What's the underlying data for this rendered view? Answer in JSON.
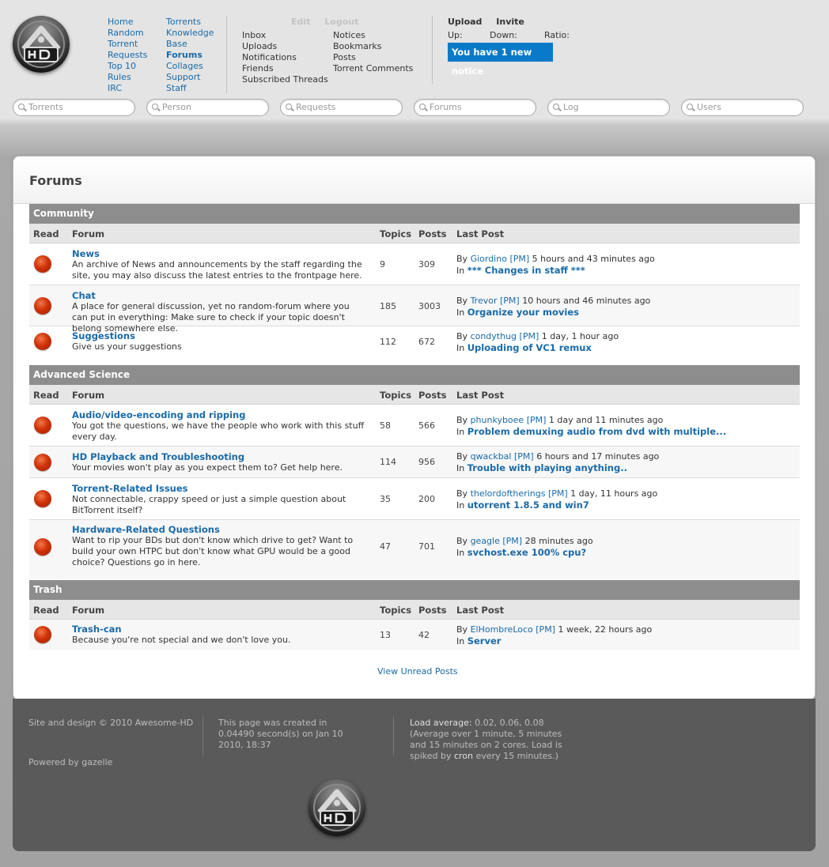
{
  "header": {
    "nav_col1": [
      "Home",
      "Random Torrent",
      "Requests",
      "Top 10",
      "Rules",
      "IRC"
    ],
    "nav_col2": [
      "Torrents",
      "Knowledge Base",
      "Forums",
      "Collages",
      "Support",
      "Staff"
    ],
    "user_edit": "Edit",
    "user_logout": "Logout",
    "user_links_col1": [
      "Inbox",
      "Uploads",
      "Notifications",
      "Friends",
      "Subscribed Threads"
    ],
    "user_links_col2": [
      "Notices",
      "Bookmarks",
      "Posts",
      "Torrent Comments"
    ],
    "upload": "Upload",
    "invite": "Invite",
    "stat_up": "Up:",
    "stat_down": "Down:",
    "stat_ratio": "Ratio:",
    "notice": "You have 1 new notice"
  },
  "searches": [
    "Torrents",
    "Person",
    "Requests",
    "Forums",
    "Log",
    "Users"
  ],
  "page_title": "Forums",
  "columns": {
    "read": "Read",
    "forum": "Forum",
    "topics": "Topics",
    "posts": "Posts",
    "last_post": "Last Post"
  },
  "categories": [
    {
      "name": "Community",
      "forums": [
        {
          "name": "News",
          "desc": "An archive of News and announcements by the staff regarding the site, you may also discuss the latest entries to the frontpage here.",
          "topics": "9",
          "posts": "309",
          "by": "By",
          "user": "Giordino",
          "pm": "[PM]",
          "time": "5 hours and 43 minutes ago",
          "in": "In",
          "thread": "*** Changes in staff ***"
        },
        {
          "name": "Chat",
          "desc": "A place for general discussion, yet no random-forum where you can put in everything: Make sure to check if your topic doesn't belong somewhere else.",
          "topics": "185",
          "posts": "3003",
          "by": "By",
          "user": "Trevor",
          "pm": "[PM]",
          "time": "10 hours and 46 minutes ago",
          "in": "In",
          "thread": "Organize your movies"
        },
        {
          "name": "Suggestions",
          "desc": "Give us your suggestions",
          "topics": "112",
          "posts": "672",
          "by": "By",
          "user": "condythug",
          "pm": "[PM]",
          "time": "1 day, 1 hour ago",
          "in": "In",
          "thread": "Uploading of VC1 remux"
        }
      ]
    },
    {
      "name": "Advanced Science",
      "forums": [
        {
          "name": "Audio/video-encoding and ripping",
          "desc": "You got the questions, we have the people who work with this stuff every day.",
          "topics": "58",
          "posts": "566",
          "by": "By",
          "user": "phunkyboee",
          "pm": "[PM]",
          "time": "1 day and 11 minutes ago",
          "in": "In",
          "thread": "Problem demuxing audio from dvd with multiple..."
        },
        {
          "name": "HD Playback and Troubleshooting",
          "desc": "Your movies won't play as you expect them to? Get help here.",
          "topics": "114",
          "posts": "956",
          "by": "By",
          "user": "qwackbal",
          "pm": "[PM]",
          "time": "6 hours and 17 minutes ago",
          "in": "In",
          "thread": "Trouble with playing anything.."
        },
        {
          "name": "Torrent-Related Issues",
          "desc": "Not connectable, crappy speed or just a simple question about BitTorrent itself?",
          "topics": "35",
          "posts": "200",
          "by": "By",
          "user": "thelordoftherings",
          "pm": "[PM]",
          "time": "1 day, 11 hours ago",
          "in": "In",
          "thread": "utorrent 1.8.5 and win7"
        },
        {
          "name": "Hardware-Related Questions",
          "desc": "Want to rip your BDs but don't know which drive to get? Want to build your own HTPC but don't know what GPU would be a good choice? Questions go in here.",
          "topics": "47",
          "posts": "701",
          "by": "By",
          "user": "geagle",
          "pm": "[PM]",
          "time": "28 minutes ago",
          "in": "In",
          "thread": "svchost.exe 100% cpu?"
        }
      ]
    },
    {
      "name": "Trash",
      "forums": [
        {
          "name": "Trash-can",
          "desc": "Because you're not special and we don't love you.",
          "topics": "13",
          "posts": "42",
          "by": "By",
          "user": "ElHombreLoco",
          "pm": "[PM]",
          "time": "1 week, 22 hours ago",
          "in": "In",
          "thread": "Server"
        }
      ]
    }
  ],
  "view_unread": "View Unread Posts",
  "footer": {
    "copyright": "Site and design © 2010 Awesome-HD",
    "powered": "Powered by gazelle",
    "created": "This page was created in 0.04490 second(s) on Jan 10 2010, 18:37",
    "load_label": "Load average:",
    "load": "0.02, 0.06, 0.08 (Average over 1 minute, 5 minutes and 15 minutes on 2 cores. Load is spiked by",
    "cron": "cron",
    "load_tail": "every 15 minutes.)"
  },
  "colors": {
    "accent": "#0a7ac8",
    "link": "#1a6aa8",
    "category": "#8d8d8d",
    "read_dot": "#cf3208"
  },
  "icons": [
    "hd-logo-icon",
    "search-icon",
    "read-status-icon"
  ]
}
